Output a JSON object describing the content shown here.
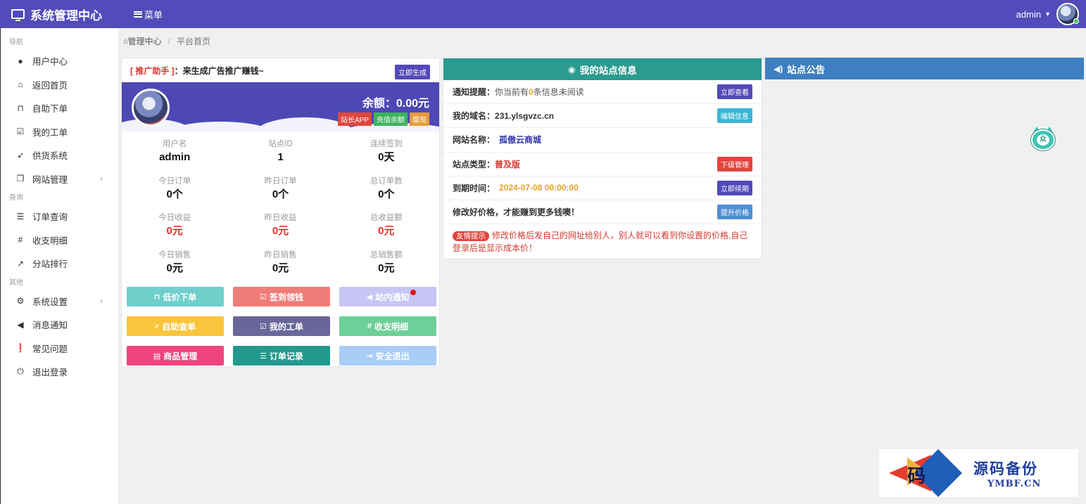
{
  "app": {
    "title": "系统管理中心",
    "menu_label": "菜单",
    "username": "admin"
  },
  "sidebar": {
    "sections": [
      {
        "label": "导航",
        "items": [
          {
            "label": "用户中心",
            "icon": "user-icon"
          },
          {
            "label": "返回首页",
            "icon": "home-icon"
          },
          {
            "label": "自助下单",
            "icon": "cart-icon"
          },
          {
            "label": "我的工单",
            "icon": "checkbox-icon"
          },
          {
            "label": "供货系统",
            "icon": "rocket-icon"
          },
          {
            "label": "网站管理",
            "icon": "cube-icon",
            "has_children": true
          }
        ]
      },
      {
        "label": "查询",
        "items": [
          {
            "label": "订单查询",
            "icon": "list-icon"
          },
          {
            "label": "收支明细",
            "icon": "hash-icon"
          },
          {
            "label": "分站排行",
            "icon": "chart-icon"
          }
        ]
      },
      {
        "label": "其他",
        "items": [
          {
            "label": "系统设置",
            "icon": "settings-icon",
            "has_children": true
          },
          {
            "label": "消息通知",
            "icon": "bullhorn-icon"
          },
          {
            "label": "常见问题",
            "icon": "question-icon"
          },
          {
            "label": "退出登录",
            "icon": "power-icon"
          }
        ]
      }
    ]
  },
  "breadcrumb": {
    "root": "管理中心",
    "current": "平台首页"
  },
  "promo": {
    "tag": "[ 推广助手 ]",
    "text": "：来生成广告推广赚钱~",
    "button": "立即生成"
  },
  "account": {
    "balance": "余额：0.00元",
    "buttons": [
      "站长APP",
      "充值余额",
      "提现"
    ],
    "stats": [
      [
        {
          "label": "用户名",
          "value": "admin"
        },
        {
          "label": "站点ID",
          "value": "1"
        },
        {
          "label": "连续签到",
          "value": "0天"
        }
      ],
      [
        {
          "label": "今日订单",
          "value": "0个"
        },
        {
          "label": "昨日订单",
          "value": "0个"
        },
        {
          "label": "总订单数",
          "value": "0个"
        }
      ],
      [
        {
          "label": "今日收益",
          "value": "0元",
          "red": true
        },
        {
          "label": "昨日收益",
          "value": "0元",
          "red": true
        },
        {
          "label": "总收益额",
          "value": "0元",
          "red": true
        }
      ],
      [
        {
          "label": "今日销售",
          "value": "0元"
        },
        {
          "label": "昨日销售",
          "value": "0元"
        },
        {
          "label": "总销售额",
          "value": "0元"
        }
      ]
    ]
  },
  "quick_buttons": [
    {
      "label": "低价下单",
      "icon": "cart-icon",
      "color": "#6fcfcb"
    },
    {
      "label": "签到领钱",
      "icon": "checkbox-icon",
      "color": "#f07c78"
    },
    {
      "label": "站内通知",
      "icon": "bullhorn-icon",
      "color": "#c7c6f4",
      "badge_dot": true
    },
    {
      "label": "自助查单",
      "icon": "search-icon",
      "color": "#f8c53c"
    },
    {
      "label": "我的工单",
      "icon": "checkbox-icon",
      "color": "#6b669a"
    },
    {
      "label": "收支明细",
      "icon": "hash-icon",
      "color": "#6ecf98"
    },
    {
      "label": "商品管理",
      "icon": "card-icon",
      "color": "#f0447f"
    },
    {
      "label": "订单记录",
      "icon": "list-icon",
      "color": "#21998c"
    },
    {
      "label": "安全退出",
      "icon": "logout-icon",
      "color": "#a9cdf7"
    }
  ],
  "site_info": {
    "title": "我的站点信息",
    "notice_prefix": "通知提醒：",
    "notice_before": "你当前有",
    "notice_count": "0",
    "notice_after": "条信息未阅读",
    "notice_btn": "立即查看",
    "domain_label": "我的域名：",
    "domain": "231.ylsgvzc.cn",
    "domain_btn": "编辑信息",
    "name_label": "网站名称：",
    "name": "孤傲云商城",
    "type_label": "站点类型：",
    "type": "普及版",
    "type_btn": "下级管理",
    "expire_label": "到期时间：",
    "expire": "2024-07-08 00:00:00",
    "expire_btn": "立即续期",
    "price_text": "修改好价格，才能赚到更多钱噢！",
    "price_btn": "提升价格",
    "tip_tag": "友情提示",
    "tip_text": "修改价格后发自己的网址给别人，别人就可以看到你设置的价格,自己登录后是显示成本价！"
  },
  "notice": {
    "title": "站点公告"
  },
  "watermark": {
    "logo_char": "码",
    "title": "源码备份",
    "domain": "YMBF.CN"
  },
  "colors": {
    "brand": "#524bba",
    "teal": "#2b9a8f",
    "blue": "#3d7fc1",
    "danger": "#d33a2f"
  }
}
